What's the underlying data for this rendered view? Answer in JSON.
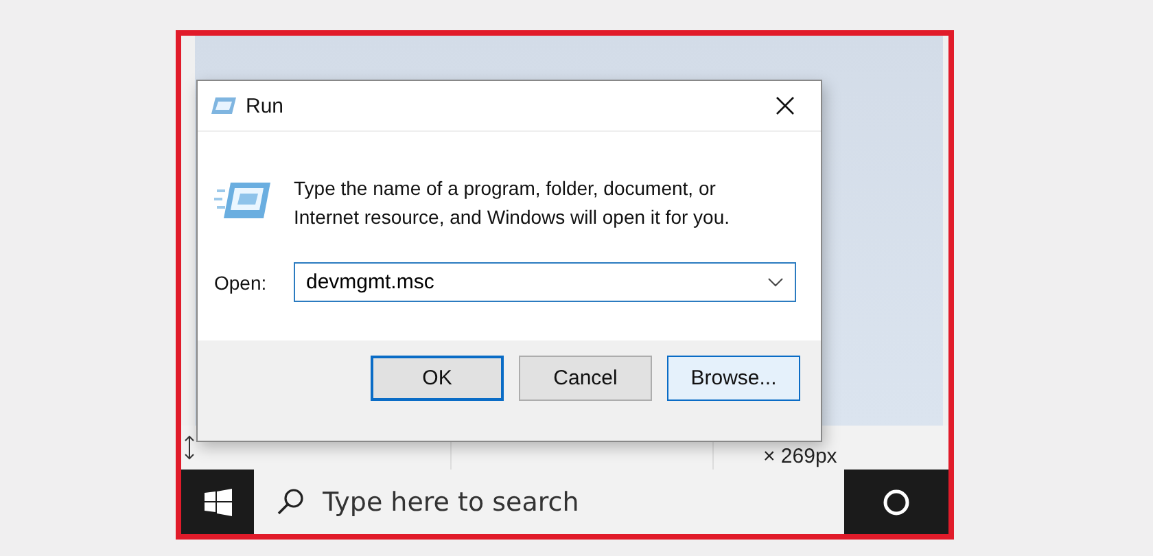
{
  "dialog": {
    "title": "Run",
    "message": "Type the name of a program, folder, document, or Internet resource, and Windows will open it for you.",
    "open_label": "Open:",
    "open_value": "devmgmt.msc",
    "buttons": [
      {
        "label": "OK",
        "kind": "default"
      },
      {
        "label": "Cancel",
        "kind": "normal"
      },
      {
        "label": "Browse...",
        "kind": "hover"
      }
    ]
  },
  "status_bar": {
    "size_text": "× 269px"
  },
  "taskbar": {
    "search": {
      "placeholder": "Type here to search"
    }
  }
}
